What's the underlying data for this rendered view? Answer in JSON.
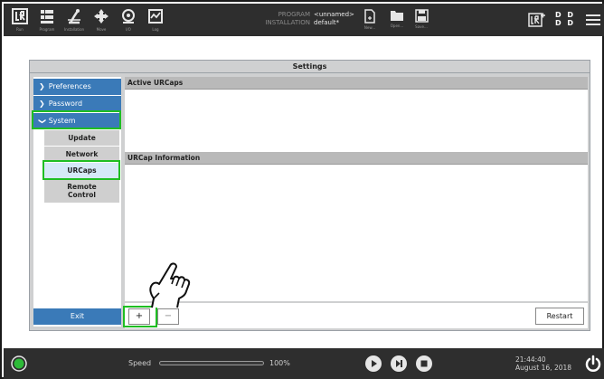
{
  "topbar": {
    "nav_buttons": [
      {
        "label": "Run",
        "icon": "ur-logo-icon"
      },
      {
        "label": "Program",
        "icon": "program-icon"
      },
      {
        "label": "Installation",
        "icon": "installation-icon"
      },
      {
        "label": "Move",
        "icon": "move-icon"
      },
      {
        "label": "I/O",
        "icon": "io-icon"
      },
      {
        "label": "Log",
        "icon": "log-icon"
      }
    ],
    "program_key": "PROGRAM",
    "program_value": "<unnamed>",
    "installation_key": "INSTALLATION",
    "installation_value": "default*",
    "file_buttons": [
      {
        "label": "New...",
        "icon": "new-file-icon"
      },
      {
        "label": "Open...",
        "icon": "open-folder-icon"
      },
      {
        "label": "Save...",
        "icon": "save-icon"
      }
    ],
    "mode_indicator": "D D\nD D"
  },
  "settings": {
    "title": "Settings",
    "nav": {
      "preferences": "Preferences",
      "password": "Password",
      "system": "System",
      "update": "Update",
      "network": "Network",
      "urcaps": "URCaps",
      "remote_control_1": "Remote",
      "remote_control_2": "Control"
    },
    "exit_label": "Exit",
    "active_urcaps_header": "Active URCaps",
    "urcap_info_header": "URCap Information",
    "add_label": "+",
    "remove_label": "−",
    "restart_label": "Restart"
  },
  "bottombar": {
    "speed_label": "Speed",
    "speed_value": "100%",
    "speed_fraction": 1.0,
    "time": "21:44:40",
    "date": "August 16, 2018"
  },
  "colors": {
    "bar_bg": "#2e2e2e",
    "accent_blue": "#3a7ab8",
    "highlight_green": "#1fbe22",
    "selected_sub": "#d5e9f7",
    "status_green": "#2dbb38"
  }
}
